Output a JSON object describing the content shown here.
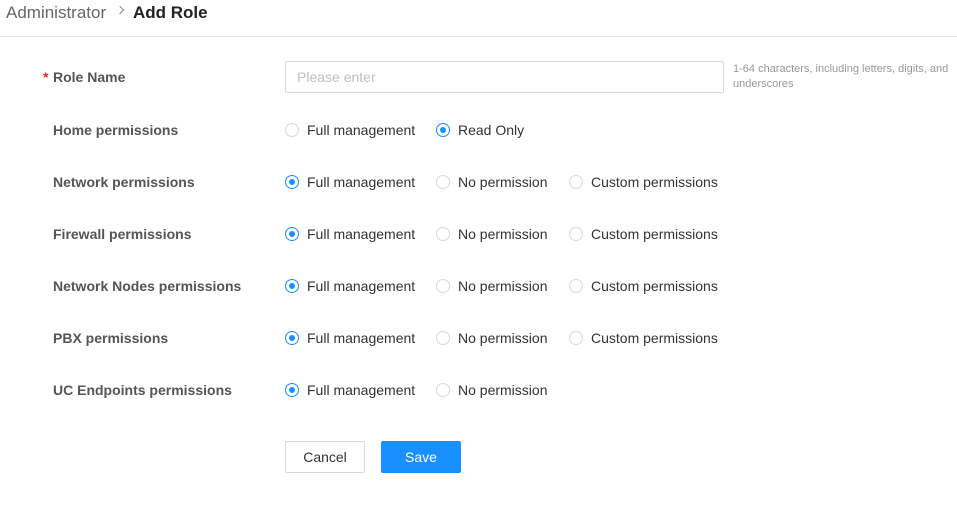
{
  "breadcrumb": {
    "root": "Administrator",
    "current": "Add Role"
  },
  "role_name": {
    "label": "Role Name",
    "required_mark": "*",
    "placeholder": "Please enter",
    "value": "",
    "hint": "1-64 characters, including letters, digits, and underscores"
  },
  "permissions": [
    {
      "label": "Home permissions",
      "options": [
        "Full management",
        "Read Only"
      ],
      "selected": "Read Only"
    },
    {
      "label": "Network permissions",
      "options": [
        "Full management",
        "No permission",
        "Custom permissions"
      ],
      "selected": "Full management"
    },
    {
      "label": "Firewall permissions",
      "options": [
        "Full management",
        "No permission",
        "Custom permissions"
      ],
      "selected": "Full management"
    },
    {
      "label": "Network Nodes permissions",
      "options": [
        "Full management",
        "No permission",
        "Custom permissions"
      ],
      "selected": "Full management"
    },
    {
      "label": "PBX permissions",
      "options": [
        "Full management",
        "No permission",
        "Custom permissions"
      ],
      "selected": "Full management"
    },
    {
      "label": "UC Endpoints permissions",
      "options": [
        "Full management",
        "No permission"
      ],
      "selected": "Full management"
    }
  ],
  "buttons": {
    "cancel": "Cancel",
    "save": "Save"
  },
  "colors": {
    "accent": "#1890ff",
    "required": "#f5222d"
  }
}
